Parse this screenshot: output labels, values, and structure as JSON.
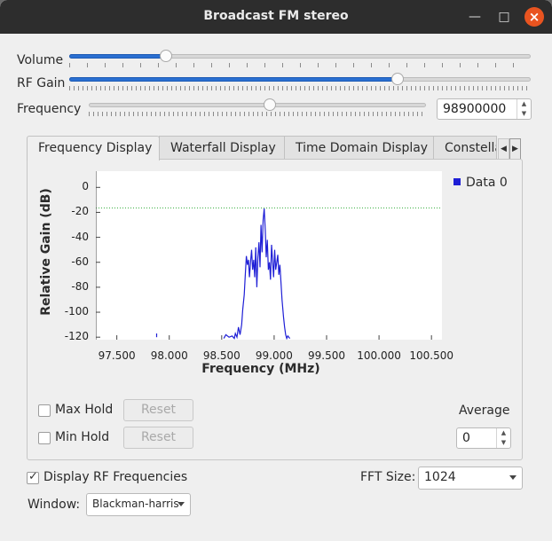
{
  "window": {
    "title": "Broadcast FM stereo"
  },
  "controls": {
    "volume": {
      "label": "Volume",
      "level": 0.209
    },
    "rf_gain": {
      "label": "RF Gain",
      "level": 0.712
    },
    "frequency": {
      "label": "Frequency",
      "level": 0.537,
      "value": "98900000"
    }
  },
  "tabs": [
    {
      "label": "Frequency Display"
    },
    {
      "label": "Waterfall Display"
    },
    {
      "label": "Time Domain Display"
    },
    {
      "label": "Constella"
    }
  ],
  "chart_data": {
    "type": "line",
    "xlabel": "Frequency (MHz)",
    "ylabel": "Relative Gain (dB)",
    "xlim": [
      97.3,
      100.6
    ],
    "ylim": [
      -122,
      13
    ],
    "x_ticks": [
      "97.500",
      "98.000",
      "98.500",
      "99.000",
      "99.500",
      "100.000",
      "100.500"
    ],
    "y_ticks": [
      "0",
      "-20",
      "-40",
      "-60",
      "-80",
      "-100",
      "-120"
    ],
    "reference_line": -16.5,
    "series": [
      {
        "name": "Data 0",
        "color": "#1f1fd6",
        "x": [
          98.52,
          98.54,
          98.57,
          98.6,
          98.62,
          98.63,
          98.645,
          98.66,
          98.675,
          98.69,
          98.7,
          98.715,
          98.725,
          98.735,
          98.745,
          98.755,
          98.765,
          98.775,
          98.785,
          98.795,
          98.805,
          98.815,
          98.825,
          98.835,
          98.845,
          98.855,
          98.865,
          98.875,
          98.885,
          98.895,
          98.905,
          98.915,
          98.925,
          98.935,
          98.945,
          98.955,
          98.965,
          98.975,
          98.985,
          98.995,
          99.005,
          99.015,
          99.025,
          99.035,
          99.045,
          99.055,
          99.065,
          99.075,
          99.09,
          99.1,
          99.11,
          99.12,
          99.13,
          99.15
        ],
        "y": [
          -121,
          -118,
          -120,
          -119,
          -121,
          -117,
          -120,
          -112,
          -118,
          -110,
          -98,
          -86,
          -70,
          -55,
          -62,
          -58,
          -72,
          -60,
          -50,
          -66,
          -58,
          -72,
          -48,
          -80,
          -56,
          -44,
          -64,
          -30,
          -52,
          -26,
          -17,
          -34,
          -56,
          -42,
          -66,
          -60,
          -74,
          -46,
          -58,
          -72,
          -50,
          -66,
          -60,
          -54,
          -70,
          -62,
          -76,
          -90,
          -104,
          -112,
          -118,
          -121,
          -119,
          -121
        ]
      }
    ],
    "sparse_points": [
      {
        "x": 97.88,
        "y": -120
      },
      {
        "x": 97.88,
        "y": -117
      }
    ]
  },
  "frequency_panel": {
    "max_hold": {
      "label": "Max Hold",
      "checked": false,
      "reset": "Reset"
    },
    "min_hold": {
      "label": "Min Hold",
      "checked": false,
      "reset": "Reset"
    },
    "average": {
      "label": "Average",
      "value": "0"
    }
  },
  "bottom": {
    "display_rf": {
      "label": "Display RF Frequencies",
      "checked": true
    },
    "fft_size": {
      "label": "FFT Size:",
      "value": "1024"
    },
    "window": {
      "label": "Window:",
      "value": "Blackman-harris"
    }
  }
}
